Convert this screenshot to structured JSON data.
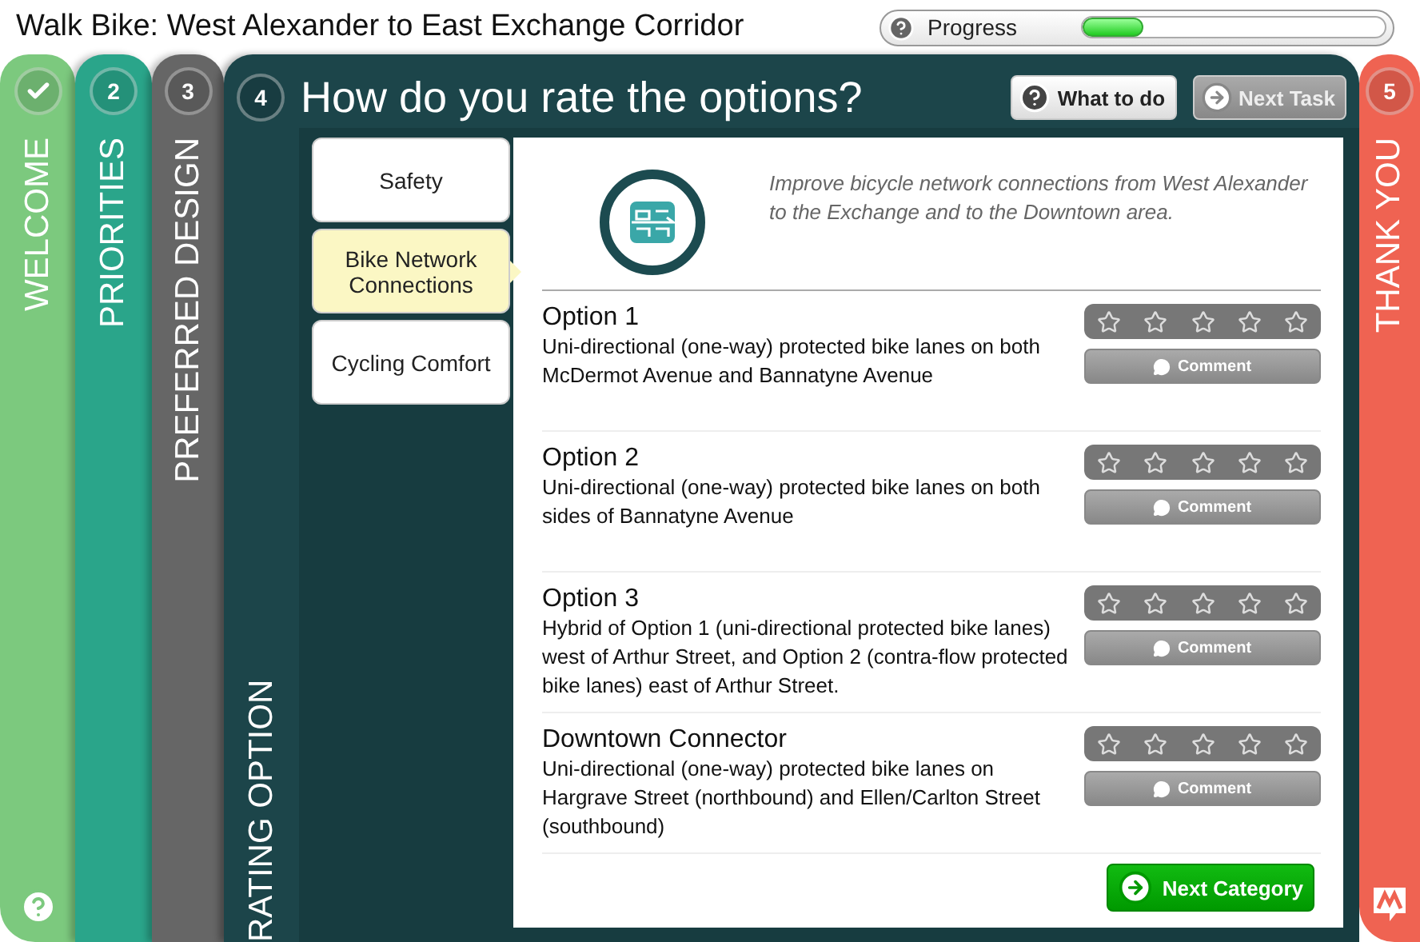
{
  "header": {
    "title": "Walk Bike: West Alexander to East Exchange Corridor",
    "progress": {
      "label": "Progress",
      "level": 0.2
    }
  },
  "stages": [
    {
      "label": "WELCOME",
      "completed": true,
      "current": false,
      "color": "#7cc97e"
    },
    {
      "number": "2",
      "label": "PRIORITIES",
      "completed": false,
      "current": false,
      "color": "#2aa58a"
    },
    {
      "number": "3",
      "label": "PREFERRED DESIGN",
      "completed": false,
      "current": false,
      "color": "#666666"
    },
    {
      "number": "4",
      "label": "RATING OPTION",
      "completed": false,
      "current": true,
      "color": "#1c454a"
    }
  ],
  "panel": {
    "title": "How do you rate the options?",
    "buttons": [
      {
        "kind": "help",
        "label": "What to do",
        "disabled": false
      },
      {
        "kind": "next",
        "label": "Next Task",
        "disabled": true
      }
    ],
    "categories": [
      {
        "label": "Safety",
        "selected": false
      },
      {
        "label": "Bike Network Connections",
        "selected": true
      },
      {
        "label": "Cycling Comfort",
        "selected": false
      }
    ],
    "intro": "Improve bicycle network connections from West Alexander to the Exchange and to the Downtown area.",
    "options": [
      {
        "title": "Option 1",
        "description": "Uni-directional (one-way) protected bike lanes on both McDermot Avenue and Bannatyne Avenue",
        "stars": 0,
        "comment": "Comment"
      },
      {
        "title": "Option 2",
        "description": "Uni-directional (one-way) protected bike lanes on both sides of Bannatyne Avenue",
        "stars": 0,
        "comment": "Comment"
      },
      {
        "title": "Option 3",
        "description": "Hybrid of Option 1 (uni-directional protected bike lanes) west of Arthur Street, and Option 2 (contra-flow protected bike lanes) east of Arthur Street.",
        "stars": 0,
        "comment": "Comment"
      },
      {
        "title": "Downtown Connector",
        "description": "Uni-directional (one-way) protected bike lanes on Hargrave Street (northbound) and Ellen/Carlton Street (southbound)",
        "stars": 0,
        "comment": "Comment"
      }
    ],
    "next_button": "Next Category"
  },
  "final_stage": {
    "number": "5",
    "label": "THANK YOU",
    "color": "#ef6352"
  }
}
